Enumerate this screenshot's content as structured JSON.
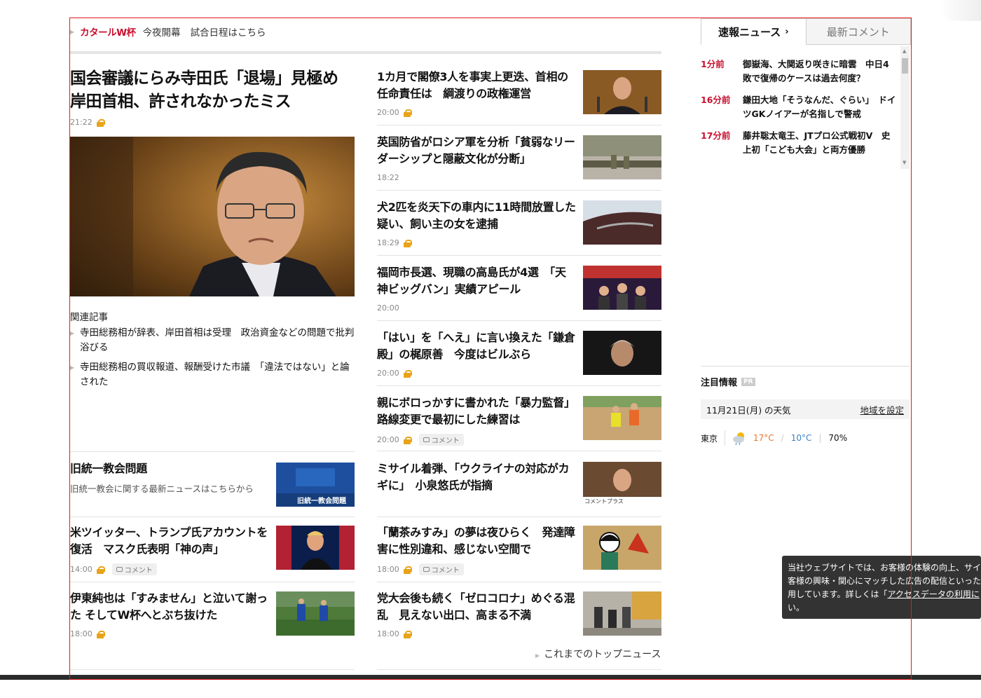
{
  "ticker": {
    "label": "カタールW杯",
    "text1": "今夜開幕",
    "text2": "試合日程はこちら"
  },
  "lead": {
    "title_line1": "国会審議にらみ寺田氏「退場」見極め",
    "title_line2": "岸田首相、許されなかったミス",
    "time": "21:22",
    "related_heading": "関連記事",
    "related": [
      "寺田総務相が辞表、岸田首相は受理　政治資金などの問題で批判浴びる",
      "寺田総務相の買収報道、報酬受けた市議　「違法ではない」と論された"
    ]
  },
  "left_items": [
    {
      "title": "旧統一教会問題",
      "sub": "旧統一教会に関する最新ニュースはこちらから",
      "thumb_caption": "旧統一教会問題"
    },
    {
      "title": "米ツイッター、トランプ氏アカウントを復活　マスク氏表明「神の声」",
      "time": "14:00",
      "comment": "コメント"
    },
    {
      "title": "伊東純也は「すみません」と泣いて謝った そしてW杯へとぶち抜けた",
      "time": "18:00"
    }
  ],
  "right_items": [
    {
      "title": "1カ月で閣僚3人を事実上更迭、首相の任命責任は　綱渡りの政権運営",
      "time": "20:00"
    },
    {
      "title": "英国防省がロシア軍を分析「貧弱なリーダーシップと隠蔽文化が分断」",
      "time": "18:22"
    },
    {
      "title": "犬2匹を炎天下の車内に11時間放置した疑い、飼い主の女を逮捕",
      "time": "18:29"
    },
    {
      "title": "福岡市長選、現職の高島氏が4選　「天神ビッグバン」実績アピール",
      "time": "20:00"
    },
    {
      "title": "「はい」を「へえ」に言い換えた「鎌倉殿」の梶原善　今度はビルぶら",
      "time": "20:00"
    },
    {
      "title": "親にボロっかすに書かれた「暴力監督」路線変更で最初にした練習は",
      "time": "20:00",
      "comment": "コメント"
    },
    {
      "title": "ミサイル着弾、「ウクライナの対応がカギに」　小泉悠氏が指摘",
      "thumb_caption": "コメントプラス"
    },
    {
      "title": "「蘭茶みすみ」の夢は夜ひらく　発達障害に性別違和、感じない空間で",
      "time": "18:00",
      "comment": "コメント"
    },
    {
      "title": "党大会後も続く「ゼロコロナ」めぐる混乱　見えない出口、高まる不満",
      "time": "18:00"
    }
  ],
  "more_link": "これまでのトップニュース",
  "tabs": {
    "flash": "速報ニュース",
    "comments": "最新コメント"
  },
  "flash": [
    {
      "ago": "1分前",
      "text": "御嶽海、大関返り咲きに暗雲　中日4敗で復帰のケースは過去何度？"
    },
    {
      "ago": "16分前",
      "text": "鎌田大地「そうなんだ、ぐらい」　ドイツGKノイアーが名指しで警戒"
    },
    {
      "ago": "17分前",
      "text": "藤井聡太竜王、JTプロ公式戦初V　史上初「こども大会」と両方優勝"
    }
  ],
  "attention": {
    "title": "注目情報",
    "pr": "PR"
  },
  "weather": {
    "date": "11月21日(月) の天気",
    "set_region": "地域を設定",
    "city": "東京",
    "high": "17°C",
    "low": "10°C",
    "rain": "70%"
  },
  "cookie": {
    "line1": "当社ウェブサイトでは、お客様の体験の向上、サイト",
    "line2": "客様の興味・関心にマッチした広告の配信といった目",
    "line3_pre": "用しています。詳しくは「",
    "line3_link": "アクセスデータの利用に",
    "line4": "い。"
  },
  "colors": {
    "accent": "#c8102e",
    "lock": "#e8a317",
    "frame": "#e0191e"
  }
}
